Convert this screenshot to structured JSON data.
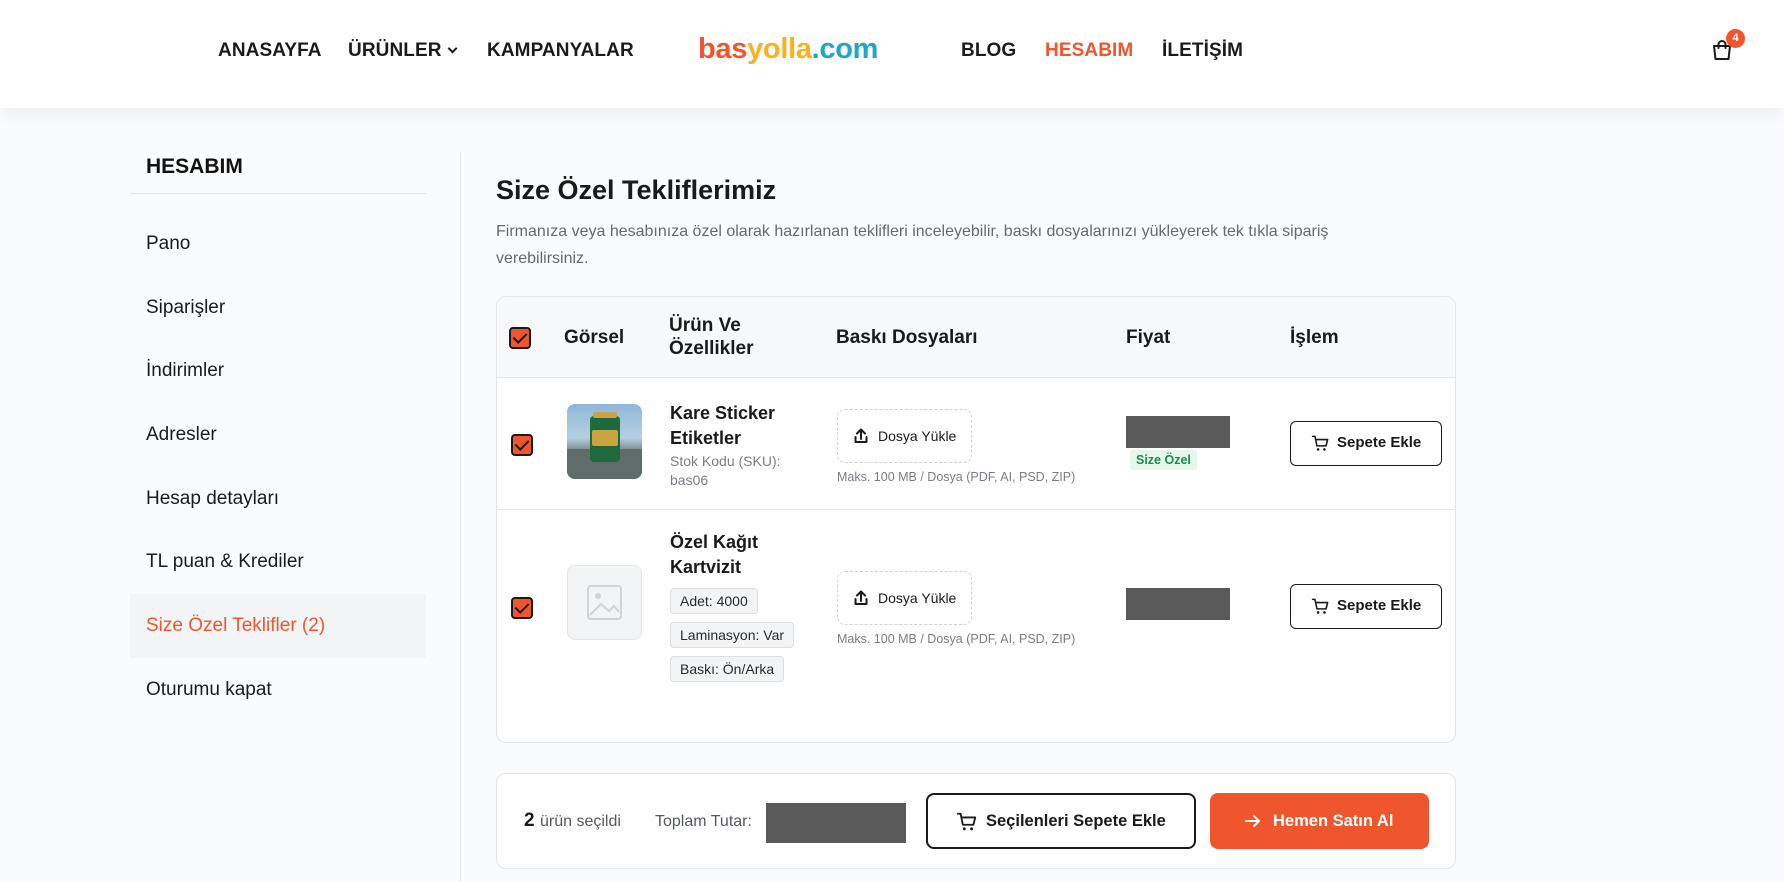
{
  "header": {
    "nav_left": [
      "ANASAYFA",
      "ÜRÜNLER",
      "KAMPANYALAR"
    ],
    "logo": {
      "part1": "bas",
      "part2": "yolla",
      "part3": ".com"
    },
    "nav_right": [
      "BLOG",
      "HESABIM",
      "İLETİŞİM"
    ],
    "cart_count": "4",
    "accent_color": "#f0562e"
  },
  "sidebar": {
    "title": "HESABIM",
    "items": [
      {
        "label": "Pano"
      },
      {
        "label": "Siparişler"
      },
      {
        "label": "İndirimler"
      },
      {
        "label": "Adresler"
      },
      {
        "label": "Hesap detayları"
      },
      {
        "label": "TL puan & Krediler"
      },
      {
        "label": "Size Özel Teklifler (2)",
        "active": true
      },
      {
        "label": "Oturumu kapat"
      }
    ]
  },
  "main": {
    "title": "Size Özel Tekliflerimiz",
    "description": "Firmanıza veya hesabınıza özel olarak hazırlanan teklifleri inceleyebilir, baskı dosyalarınızı yükleyerek tek tıkla sipariş verebilirsiniz.",
    "table": {
      "headers": {
        "image": "Görsel",
        "product_line1": "Ürün Ve",
        "product_line2": "Özellikler",
        "files": "Baskı Dosyaları",
        "price": "Fiyat",
        "action": "İşlem"
      },
      "rows": [
        {
          "name_line1": "Kare Sticker",
          "name_line2": "Etiketler",
          "sku_line1": "Stok Kodu (SKU):",
          "sku_line2": "bas06",
          "upload_label": "Dosya Yükle",
          "upload_note": "Maks. 100 MB / Dosya (PDF, AI, PSD, ZIP)",
          "tag": "Size Özel",
          "action_label": "Sepete Ekle"
        },
        {
          "name_line1": "Özel Kağıt",
          "name_line2": "Kartvizit",
          "chips": [
            "Adet:  4000",
            "Laminasyon:  Var",
            "Baskı:  Ön/Arka"
          ],
          "upload_label": "Dosya Yükle",
          "upload_note": "Maks. 100 MB / Dosya (PDF, AI, PSD, ZIP)",
          "action_label": "Sepete Ekle"
        }
      ]
    },
    "footer": {
      "selected_count": "2",
      "selected_text": "ürün seçildi",
      "total_label": "Toplam Tutar:",
      "add_selected_label": "Seçilenleri Sepete Ekle",
      "buy_now_label": "Hemen Satın Al"
    }
  }
}
